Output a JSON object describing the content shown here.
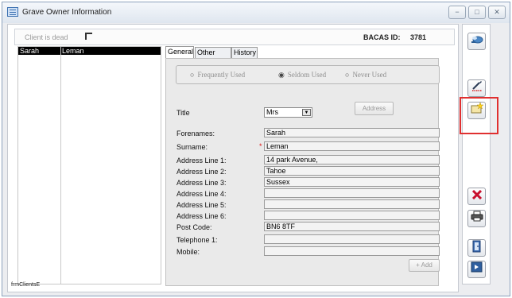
{
  "window": {
    "title": "Grave Owner Information",
    "minimize_glyph": "−",
    "maximize_glyph": "□",
    "close_glyph": "✕"
  },
  "header": {
    "client_dead_label": "Client is dead",
    "bacas_label": "BACAS ID:",
    "bacas_id": "3781"
  },
  "client_list": {
    "rows": [
      {
        "forename": "Sarah",
        "surname": "Leman",
        "selected": true
      }
    ]
  },
  "tabs": [
    {
      "label": "General",
      "active": true
    },
    {
      "label": "Other Info",
      "active": false
    },
    {
      "label": "History",
      "active": false
    }
  ],
  "usage": {
    "options": [
      "Frequently Used",
      "Seldom Used",
      "Never Used"
    ],
    "selected": "Seldom Used"
  },
  "form": {
    "title_label": "Title",
    "title_value": "Mrs",
    "address_button": "Address",
    "fields": [
      {
        "label": "Forenames:",
        "value": "Sarah",
        "required": false
      },
      {
        "label": "Surname:",
        "value": "Leman",
        "required": true
      },
      {
        "label": "Address Line 1:",
        "value": "14 park Avenue,",
        "required": false
      },
      {
        "label": "Address Line 2:",
        "value": "Tahoe",
        "required": false
      },
      {
        "label": "Address Line 3:",
        "value": "Sussex",
        "required": false
      },
      {
        "label": "Address Line 4:",
        "value": "",
        "required": false
      },
      {
        "label": "Address Line 5:",
        "value": "",
        "required": false
      },
      {
        "label": "Address Line 6:",
        "value": "",
        "required": false
      },
      {
        "label": "Post Code:",
        "value": "BN6 8TF",
        "required": false
      },
      {
        "label": "Telephone 1:",
        "value": "",
        "required": false
      },
      {
        "label": "Mobile:",
        "value": "",
        "required": false
      }
    ],
    "add_button": "+ Add"
  },
  "statusbar": {
    "form_name": "frmClientsE"
  },
  "toolbar": {
    "buttons": [
      {
        "name": "search-client-icon"
      },
      {
        "name": "edit-pencil-icon"
      },
      {
        "name": "new-record-star-icon",
        "highlighted": true
      },
      {
        "name": "delete-x-icon"
      },
      {
        "name": "print-icon"
      },
      {
        "name": "exit-door-icon"
      },
      {
        "name": "close-form-icon"
      }
    ]
  },
  "colors": {
    "highlight": "#e03030",
    "delete_red": "#c8102e",
    "required_star": "#dd1111"
  }
}
